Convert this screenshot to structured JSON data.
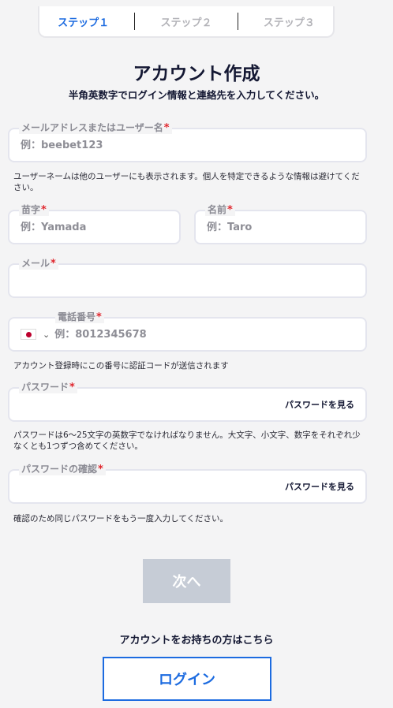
{
  "steps": [
    "ステップ１",
    "ステップ２",
    "ステップ３"
  ],
  "header": {
    "title": "アカウント作成",
    "subtitle": "半角英数字でログイン情報と連絡先を入力してください。"
  },
  "fields": {
    "username": {
      "label": "メールアドレスまたはユーザー名",
      "placeholder": "例：beebet123",
      "hint": "ユーザーネームは他のユーザーにも表示されます。個人を特定できるような情報は避けてください。"
    },
    "last_name": {
      "label": "苗字",
      "placeholder": "例：Yamada"
    },
    "first_name": {
      "label": "名前",
      "placeholder": "例：Taro"
    },
    "email": {
      "label": "メール",
      "placeholder": ""
    },
    "phone": {
      "label": "電話番号",
      "placeholder": "例：8012345678",
      "hint": "アカウント登録時にこの番号に認証コードが送信されます"
    },
    "password": {
      "label": "パスワード",
      "show_label": "パスワードを見る",
      "hint": "パスワードは6〜25文字の英数字でなければなりません。大文字、小文字、数字をそれぞれ少なくとも1つずつ含めてください。"
    },
    "password_confirm": {
      "label": "パスワードの確認",
      "show_label": "パスワードを見る",
      "hint": "確認のため同じパスワードをもう一度入力してください。"
    }
  },
  "required_mark": "*",
  "buttons": {
    "next": "次へ",
    "login": "ログイン"
  },
  "have_account": "アカウントをお持ちの方はこちら",
  "icons": {
    "country_flag": "japan-flag-icon",
    "chevron": "chevron-down-icon"
  },
  "colors": {
    "accent": "#1c6be0",
    "required": "#e0262d",
    "disabled_button": "#c6ccd6"
  }
}
